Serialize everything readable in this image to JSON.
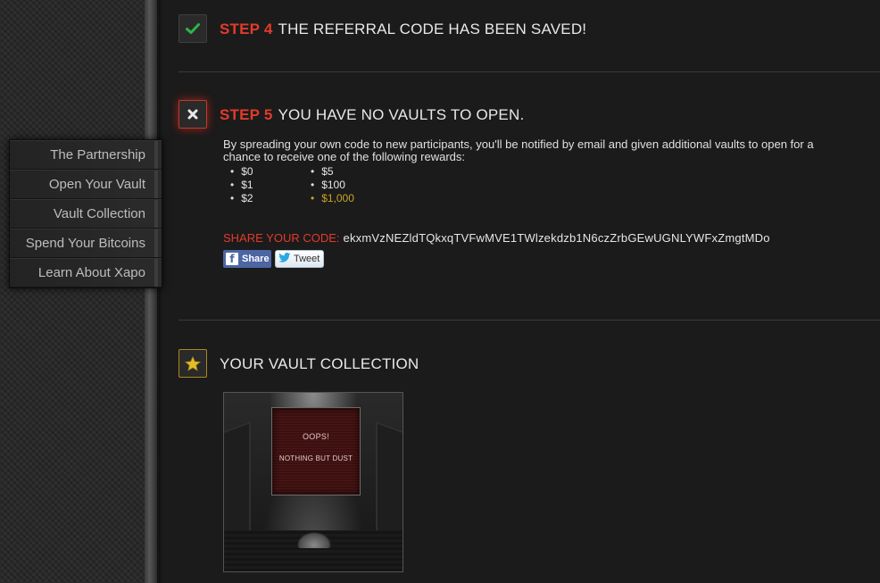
{
  "sidebar": {
    "items": [
      {
        "label": "The Partnership"
      },
      {
        "label": "Open Your Vault"
      },
      {
        "label": "Vault Collection"
      },
      {
        "label": "Spend Your Bitcoins"
      },
      {
        "label": "Learn About Xapo"
      }
    ]
  },
  "step4": {
    "number": "STEP 4",
    "title": "THE REFERRAL CODE HAS BEEN SAVED!",
    "icon": "check-icon"
  },
  "step5": {
    "number": "STEP 5",
    "title": "YOU HAVE NO VAULTS TO OPEN.",
    "icon": "x-icon",
    "description": "By spreading your own code to new participants, you'll be notified by email and given additional vaults to open for a chance to receive one of the following rewards:",
    "rewards_col1": [
      "$0",
      "$1",
      "$2"
    ],
    "rewards_col2": [
      "$5",
      "$100",
      "$1,000"
    ],
    "share_label": "SHARE YOUR CODE:",
    "share_code": "ekxmVzNEZldTQkxqTVFwMVE1TWlzekdzb1N6czZrbGEwUGNLYWFxZmgtMDo",
    "facebook_button": "Share",
    "twitter_button": "Tweet"
  },
  "collection": {
    "title": "YOUR VAULT COLLECTION",
    "icon": "star-icon",
    "vault": {
      "line1": "OOPS!",
      "line2": "NOTHING BUT DUST"
    }
  },
  "colors": {
    "accent_red": "#e23b2b",
    "gold": "#c9a227",
    "background": "#1b1b1b",
    "facebook": "#4c66a4",
    "twitter": "#2ba8e3"
  }
}
